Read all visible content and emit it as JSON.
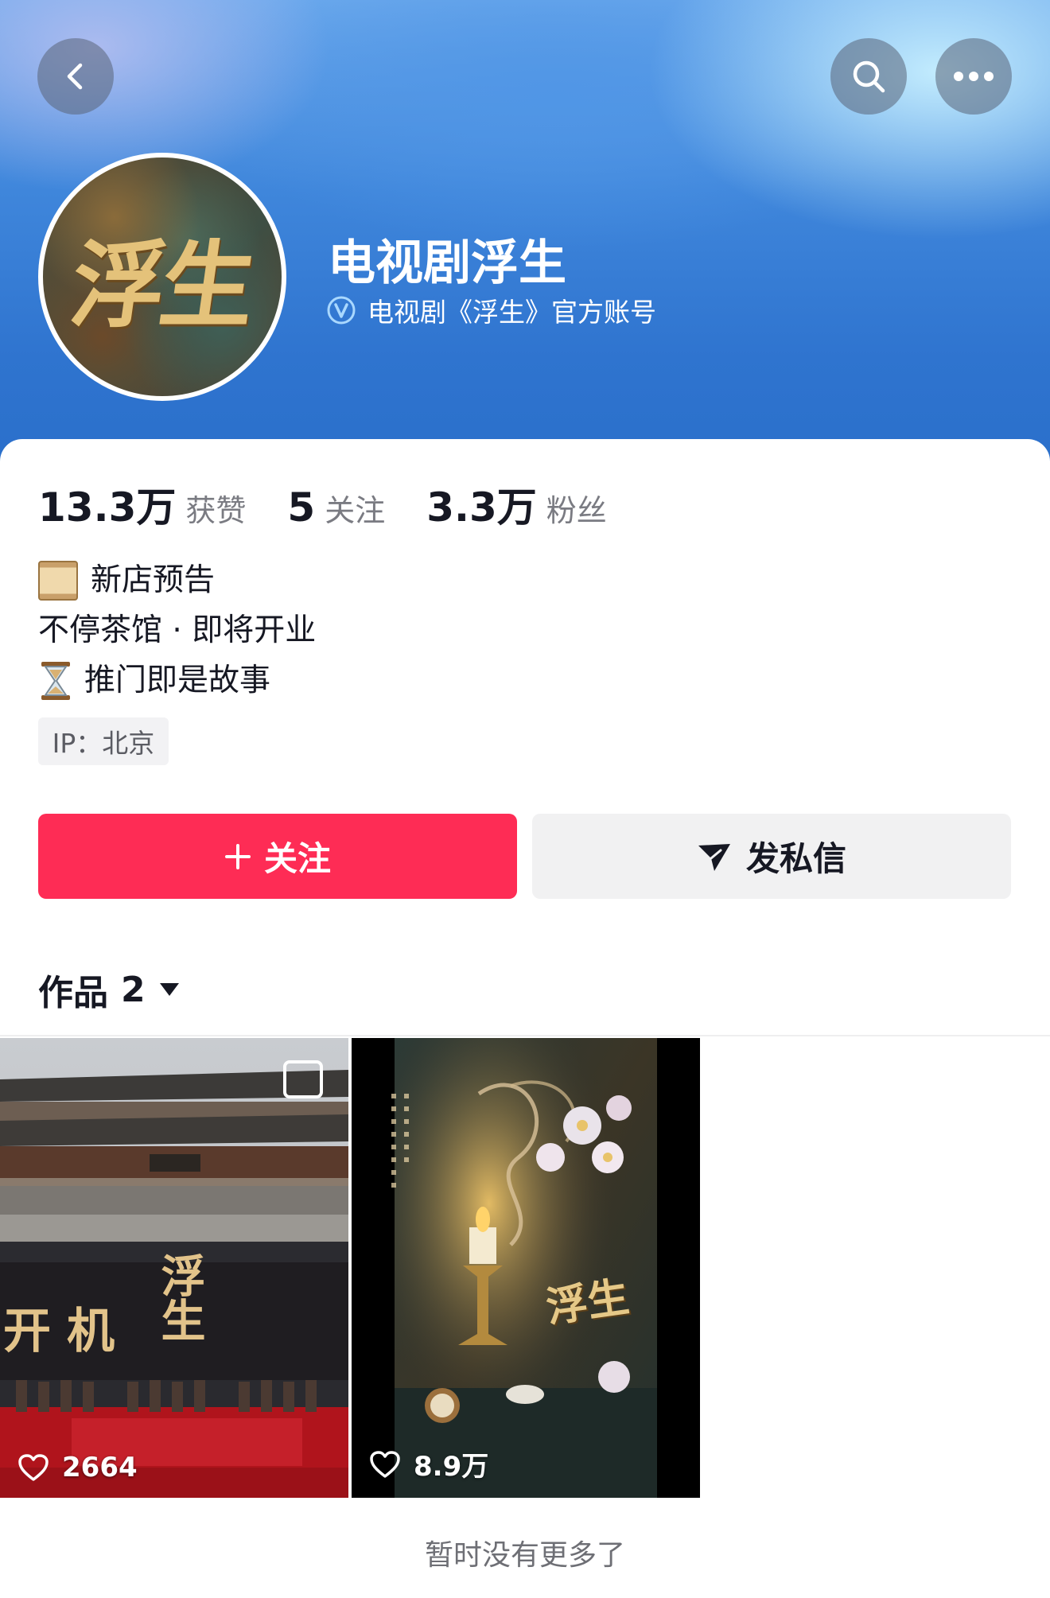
{
  "profile": {
    "nickname": "电视剧浮生",
    "verification": "电视剧《浮生》官方账号",
    "avatar_text": "浮生"
  },
  "stats": [
    {
      "value": "13.3万",
      "label": "获赞"
    },
    {
      "value": "5",
      "label": "关注"
    },
    {
      "value": "3.3万",
      "label": "粉丝"
    }
  ],
  "bio": {
    "line1": "新店预告",
    "line2": "不停茶馆 · 即将开业",
    "line3": "推门即是故事"
  },
  "ip_tag": "IP：北京",
  "actions": {
    "follow": "关注",
    "message": "发私信"
  },
  "works": {
    "label": "作品",
    "count": "2",
    "items": [
      {
        "likes": "2664",
        "banner_text": "开机",
        "title_text": "浮生"
      },
      {
        "likes": "8.9万",
        "title_text": "浮生"
      }
    ]
  },
  "footer": "暂时没有更多了",
  "colors": {
    "accent": "#fe2c55",
    "header_blue": "#2f74cf",
    "secondary_button": "#f1f1f2"
  },
  "icons": {
    "back": "chevron-left-icon",
    "search": "search-icon",
    "more": "more-horizontal-icon",
    "verified": "verified-badge-icon",
    "message": "send-icon",
    "likes": "heart-icon",
    "dropdown": "caret-down-icon"
  }
}
